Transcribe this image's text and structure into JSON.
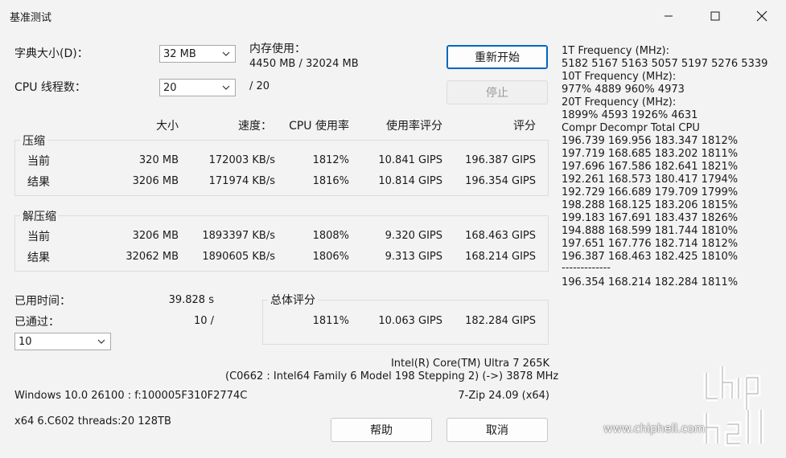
{
  "window": {
    "title": "基准测试"
  },
  "dict_size": {
    "label": "字典大小(D)：",
    "value": "32 MB"
  },
  "threads": {
    "label": "CPU 线程数：",
    "value": "20",
    "max": "/ 20"
  },
  "memory": {
    "label": "内存使用：",
    "value": "4450 MB / 32024 MB"
  },
  "buttons": {
    "restart": "重新开始",
    "stop": "停止",
    "help": "帮助",
    "cancel": "取消"
  },
  "headers": {
    "size": "大小",
    "speed": "速度：",
    "cpu": "CPU 使用率",
    "rating_usage": "使用率评分",
    "rating": "评分"
  },
  "compress": {
    "label": "压缩",
    "rows": [
      {
        "name": "当前",
        "size": "320 MB",
        "speed": "172003 KB/s",
        "cpu": "1812%",
        "usage": "10.841 GIPS",
        "rating": "196.387 GIPS"
      },
      {
        "name": "结果",
        "size": "3206 MB",
        "speed": "171974 KB/s",
        "cpu": "1816%",
        "usage": "10.814 GIPS",
        "rating": "196.354 GIPS"
      }
    ]
  },
  "decompress": {
    "label": "解压缩",
    "rows": [
      {
        "name": "当前",
        "size": "3206 MB",
        "speed": "1893397 KB/s",
        "cpu": "1808%",
        "usage": "9.320 GIPS",
        "rating": "168.463 GIPS"
      },
      {
        "name": "结果",
        "size": "32062 MB",
        "speed": "1890605 KB/s",
        "cpu": "1806%",
        "usage": "9.313 GIPS",
        "rating": "168.214 GIPS"
      }
    ]
  },
  "elapsed": {
    "label": "已用时间：",
    "value": "39.828 s"
  },
  "passes": {
    "label": "已通过：",
    "value": "10 /",
    "select": "10"
  },
  "total": {
    "label": "总体评分",
    "cpu": "1811%",
    "usage": "10.063 GIPS",
    "rating": "182.284 GIPS"
  },
  "cpuinfo": {
    "name": "Intel(R) Core(TM) Ultra 7 265K",
    "detail": "(C0662 : Intel64 Family 6 Model 198 Stepping 2) (->) 3878 MHz",
    "zip": "7-Zip 24.09 (x64)"
  },
  "sysinfo": {
    "os": "Windows 10.0 26100 : f:100005F310F2774C",
    "arch": "x64 6.C602 threads:20 128TB"
  },
  "freq": {
    "l1": "1T Frequency (MHz):",
    "v1": " 5182 5167 5163 5057 5197 5276 5339",
    "l10": "10T Frequency (MHz):",
    "v10": " 977% 4889 960% 4973",
    "l20": "20T Frequency (MHz):",
    "v20": " 1899% 4593 1926% 4631"
  },
  "log": {
    "header": "Compr Decompr Total  CPU",
    "rows": [
      "196.739 169.956 183.347  1812%",
      "197.719 168.685 183.202  1811%",
      "197.696 167.586 182.641  1821%",
      "192.261 168.573 180.417  1794%",
      "192.729 166.689 179.709  1799%",
      "198.288 168.125 183.206  1815%",
      "199.183 167.691 183.437  1826%",
      "194.888 168.599 181.744  1810%",
      "197.651 167.776 182.714  1812%",
      "196.387 168.463 182.425  1810%"
    ],
    "separator": "-------------",
    "final": "196.354 168.214 182.284  1811%"
  },
  "watermark": {
    "brand": "chip hell",
    "url": "www.chiphell.com"
  }
}
